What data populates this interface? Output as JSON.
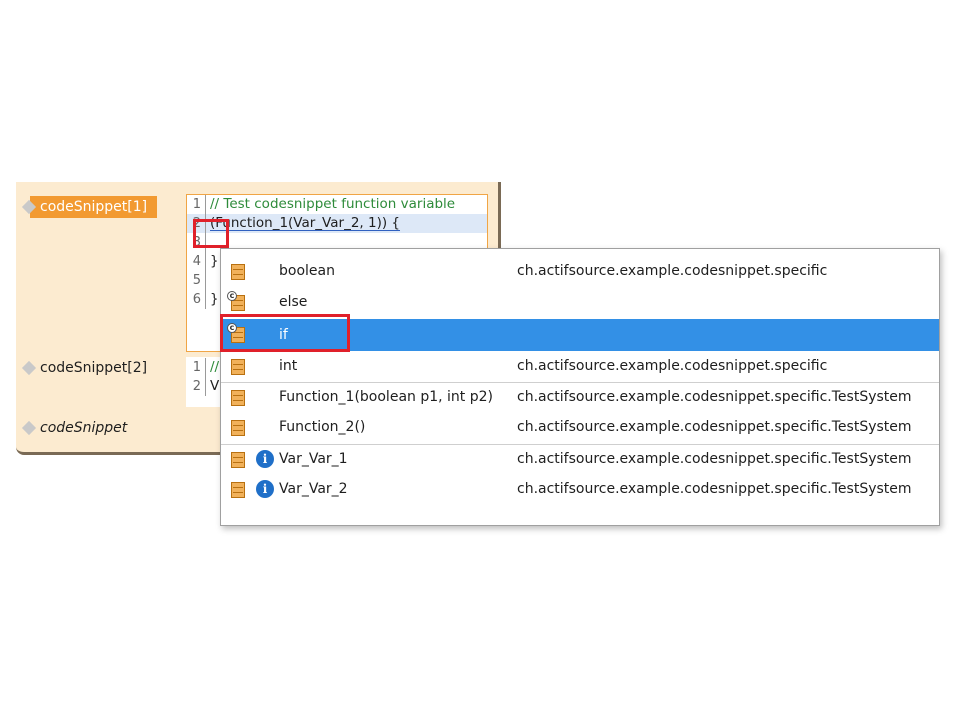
{
  "rows": [
    {
      "label": "codeSnippet[1]",
      "selected": true
    },
    {
      "label": "codeSnippet[2]",
      "selected": false
    },
    {
      "label": "codeSnippet",
      "selected": false
    }
  ],
  "snippet1": {
    "line_numbers": [
      "1",
      "2",
      "3",
      "4",
      "5",
      "6"
    ],
    "line1": "// Test codesnippet function variable",
    "line2": "(Function_1(Var_Var_2, 1)) {",
    "line4": "}",
    "line6": "}"
  },
  "snippet2": {
    "line_numbers": [
      "1",
      "2"
    ],
    "line1": "//",
    "line2": "V"
  },
  "completion": {
    "items": [
      {
        "name": "boolean",
        "package": "ch.actifsource.example.codesnippet.specific"
      },
      {
        "name": "else",
        "package": ""
      },
      {
        "name": "if",
        "package": ""
      },
      {
        "name": "int",
        "package": "ch.actifsource.example.codesnippet.specific"
      },
      {
        "name": "Function_1(boolean p1, int p2)",
        "package": "ch.actifsource.example.codesnippet.specific.TestSystem"
      },
      {
        "name": "Function_2()",
        "package": "ch.actifsource.example.codesnippet.specific.TestSystem"
      },
      {
        "name": "Var_Var_1",
        "package": "ch.actifsource.example.codesnippet.specific.TestSystem"
      },
      {
        "name": "Var_Var_2",
        "package": "ch.actifsource.example.codesnippet.specific.TestSystem"
      }
    ],
    "selected_index": 2
  },
  "icons": {
    "info_glyph": "i",
    "keyword_glyph": "c"
  },
  "colors": {
    "panel_bg": "#fcebd0",
    "selected_row": "#f29a31",
    "selection_blue": "#3390e6",
    "highlight_red": "#e0202a",
    "comment_green": "#2e8b3a"
  }
}
